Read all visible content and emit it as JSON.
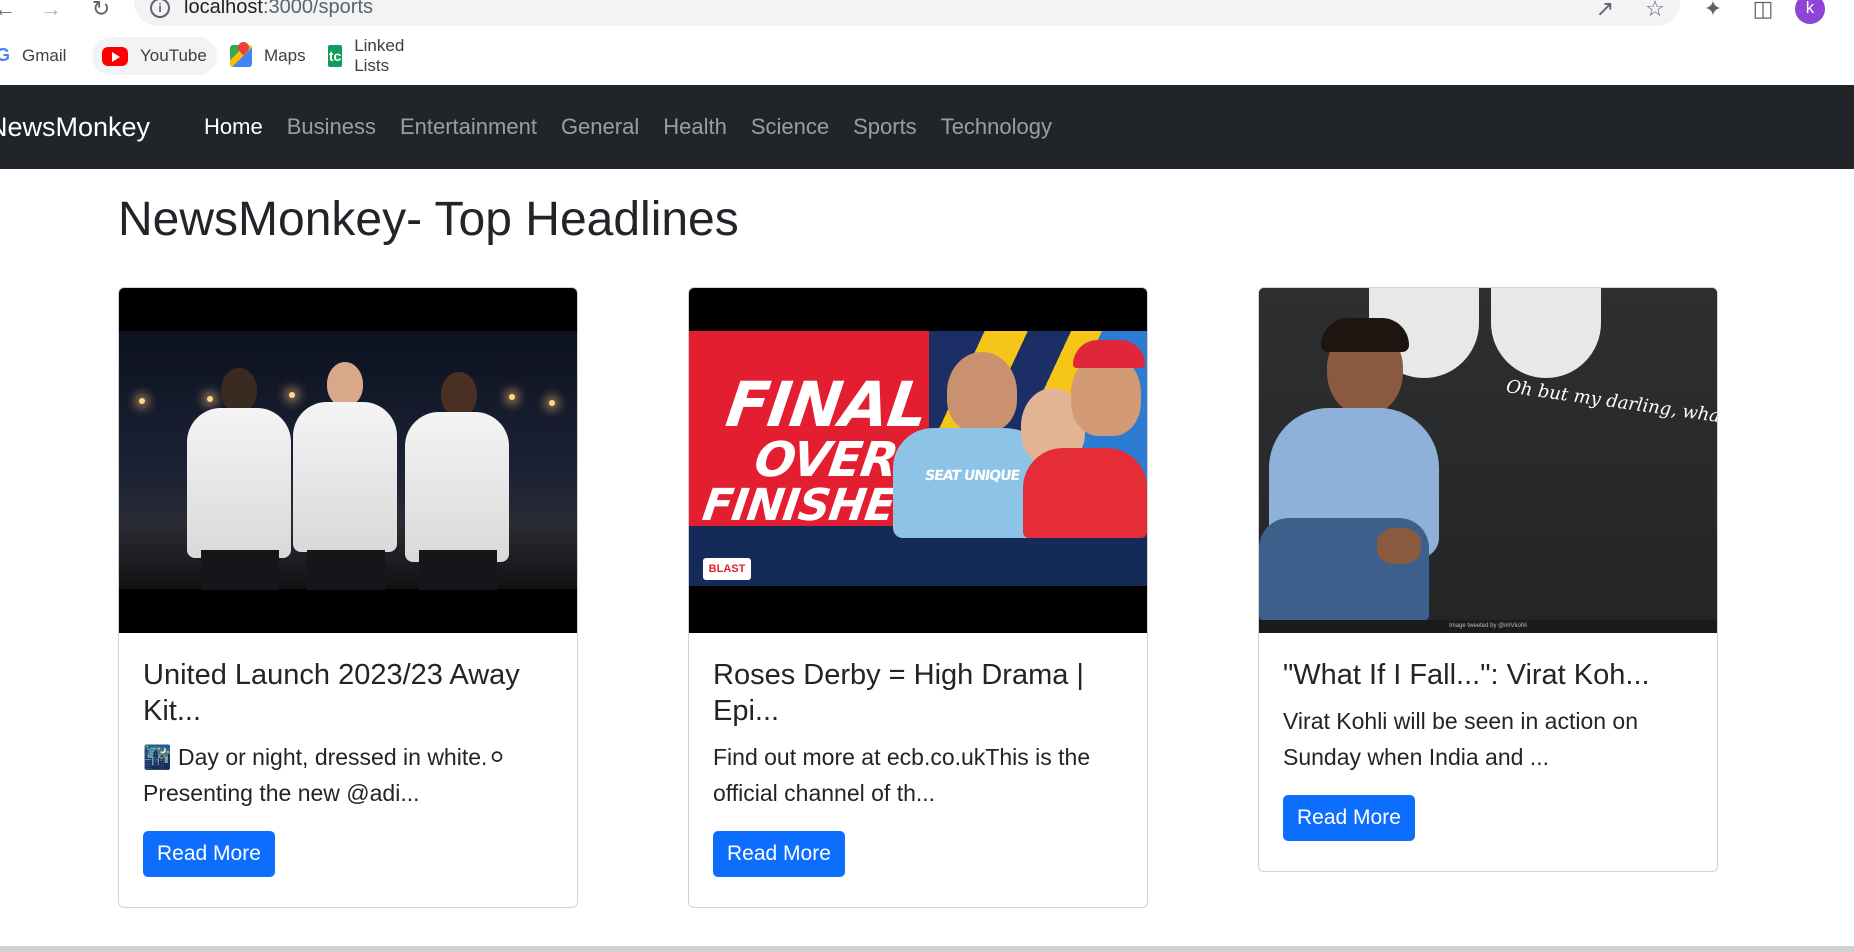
{
  "browser": {
    "url_host": "localhost",
    "url_path": ":3000/sports",
    "profile_initial": "k",
    "bookmarks": [
      {
        "label": "Gmail",
        "icon": "google-icon"
      },
      {
        "label": "YouTube",
        "icon": "youtube-icon"
      },
      {
        "label": "Maps",
        "icon": "maps-icon"
      },
      {
        "label": "Linked Lists",
        "icon": "tc-icon"
      }
    ],
    "tc_icon_text": "tc"
  },
  "navbar": {
    "brand": "NewsMonkey",
    "links": [
      {
        "label": "Home",
        "active": true
      },
      {
        "label": "Business"
      },
      {
        "label": "Entertainment"
      },
      {
        "label": "General"
      },
      {
        "label": "Health"
      },
      {
        "label": "Science"
      },
      {
        "label": "Sports"
      },
      {
        "label": "Technology"
      }
    ]
  },
  "main": {
    "heading": "NewsMonkey- Top Headlines",
    "cards": [
      {
        "title": "United Launch 2023/23 Away Kit...",
        "description": "🌃 Day or night, dressed in white.⚪ Presenting the new @adi...",
        "button": "Read More"
      },
      {
        "title": "Roses Derby = High Drama | Epi...",
        "description": "Find out more at ecb.co.ukThis is the official channel of th...",
        "button": "Read More",
        "image_text": {
          "line1": "FINAL",
          "line2": "OVER",
          "line3": "FINISHES",
          "sponsor": "SEAT UNIQUE",
          "logo": "BLAST"
        }
      },
      {
        "title": "\"What If I Fall...\": Virat Koh...",
        "description": "Virat Kohli will be seen in action on Sunday when India and ...",
        "button": "Read More",
        "image_text": {
          "script": "Oh but my darling, what if y",
          "caption": "Image tweeted by @imVkohli"
        }
      }
    ]
  },
  "colors": {
    "navbar_bg": "#212529",
    "primary_button": "#0d6efd",
    "profile_avatar": "#8e44d6"
  }
}
